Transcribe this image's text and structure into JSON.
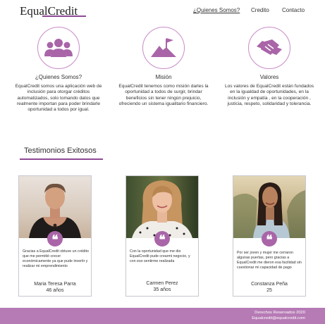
{
  "header": {
    "logo": "EqualCredit",
    "nav": [
      {
        "label": "¿Quienes Somos?",
        "active": true
      },
      {
        "label": "Credito",
        "active": false
      },
      {
        "label": "Contacto",
        "active": false
      }
    ]
  },
  "features": [
    {
      "icon": "users-icon",
      "title": "¿Quienes Somos?",
      "text": "EqualCredit somos una  aplicación web de inclusión para otorgar créditos automatizados, solo tomando datos que realmente importan para poder brindarle oportunidad a todos por igual."
    },
    {
      "icon": "mountain-flag-icon",
      "title": "Misión",
      "text": "EqualCredit tenemos como misión darles la oportunidad a todos de surgir, brindar beneficios sin tener ningún prejuicio, ofreciendo un sistema igualitario financiero."
    },
    {
      "icon": "handshake-icon",
      "title": "Valores",
      "text": "Los valores de EqualCredit están fundados en la igualdad de oportunidades, en la inclusión y empatía , en la cooperación , justicia, respeto, solidaridad  y tolerancia."
    }
  ],
  "testimonials_title": "Testimonios Exitosos",
  "testimonials": [
    {
      "quote": "Gracias a EqualCredit obtuve un crédito que me permitió crecer económicamente ya que pude invertir y realizar mi emprendimiento",
      "name": "Maria  Teresa Parra",
      "age": "46 años"
    },
    {
      "quote": "Con la oportunidad que me dio EqualCredit pude crearmi negocio, y con eso sentirme realizada",
      "name": "Carmen Perez",
      "age": "35 años"
    },
    {
      "quote": "Por ser  joven y mujer me cerraron algunas puertas, pero gracias a EqualCredit me dieron esa facilidad sin cuestionar mi capacidad de pago",
      "name": "Constanza Peña",
      "age": "25"
    }
  ],
  "footer": {
    "rights": "Derechos Reservados 2020",
    "email": "Equalcredit@equalcredit.com"
  },
  "colors": {
    "accent": "#8e4a94",
    "footer_bg": "#b67ab5",
    "icon_fill": "#a965a8",
    "icon_border": "#c98bc8"
  }
}
